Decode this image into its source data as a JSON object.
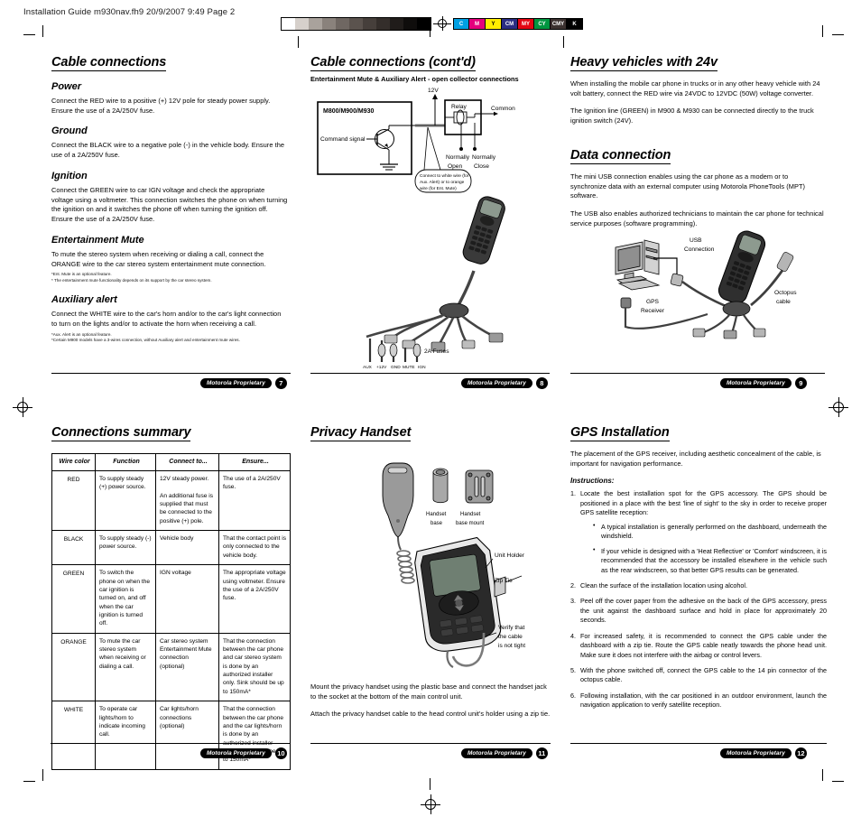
{
  "proof": {
    "header": "Installation Guide m930nav.fh9 20/9/2007 9:49 Page 2",
    "grayscale_swatches": [
      "#ffffff",
      "#d6d0cb",
      "#a9a29c",
      "#8a827c",
      "#6f6762",
      "#5b534e",
      "#463f3b",
      "#342e2b",
      "#201c1a",
      "#0f0d0c",
      "#000000"
    ],
    "cmyk_swatches": [
      {
        "label": "C",
        "color": "#00a0e3"
      },
      {
        "label": "M",
        "color": "#e5007d"
      },
      {
        "label": "Y",
        "color": "#ffec00"
      },
      {
        "label": "CM",
        "color": "#2b2e83"
      },
      {
        "label": "MY",
        "color": "#e30613"
      },
      {
        "label": "CY",
        "color": "#009640"
      },
      {
        "label": "CMY",
        "color": "#3c3230"
      },
      {
        "label": "K",
        "color": "#000000"
      }
    ]
  },
  "footer_badge_label": "Motorola Proprietary",
  "panels": {
    "cable_connections": {
      "title": "Cable connections",
      "page_number": "7",
      "sections": [
        {
          "heading": "Power",
          "paragraphs": [
            "Connect the RED wire to a positive (+) 12V pole for steady power supply. Ensure the use of a 2A/250V fuse."
          ],
          "notes": []
        },
        {
          "heading": "Ground",
          "paragraphs": [
            "Connect the BLACK wire to a negative pole (-) in the vehicle body. Ensure the use of a 2A/250V fuse."
          ],
          "notes": []
        },
        {
          "heading": "Ignition",
          "paragraphs": [
            "Connect the GREEN wire to car IGN voltage and check the appropriate voltage using a voltmeter. This connection switches the phone on when turning the ignition on and it switches the phone off when turning the ignition off. Ensure the use of a 2A/250V fuse."
          ],
          "notes": []
        },
        {
          "heading": "Entertainment Mute",
          "paragraphs": [
            "To mute the stereo system when receiving or dialing a call, connect the ORANGE wire to the car stereo system entertainment mute connection."
          ],
          "notes": [
            "*Ent. Mute is an optional feature.",
            "* The entertainment mute functionality depends on its support by the car stereo system."
          ]
        },
        {
          "heading": "Auxiliary alert",
          "paragraphs": [
            "Connect the WHITE wire to the car's horn and/or to the car's light connection to turn on the lights and/or to activate the horn when receiving a call."
          ],
          "notes": [
            "*Aux. Alert is an optional feature.",
            "*Certain M900 models have a 3-wires connection, without Auxiliary alert and entertainment mute wires."
          ]
        }
      ]
    },
    "cable_connections_contd": {
      "title": "Cable connections (cont'd)",
      "subtitle": "Entertainment Mute & Auxiliary Alert - open collector connections",
      "page_number": "8",
      "diagram": {
        "unit_label": "M800/M900/M930",
        "command_signal": "Command signal",
        "supply": "12V",
        "relay": "Relay",
        "common": "Common",
        "normally_open": [
          "Normally",
          "Open"
        ],
        "normally_close": [
          "Normally",
          "Close"
        ],
        "callout": [
          "Connect to white wire (for",
          "Aux. Alert) or to orange",
          "wire (for  Ent. Mute)"
        ],
        "fuses": "2A Fuses",
        "connector_labels": [
          "AUX",
          "+12V",
          "GND",
          "MUTE",
          "IGN"
        ]
      }
    },
    "heavy_vehicles": {
      "title": "Heavy vehicles with 24v",
      "paragraphs": [
        "When installing the mobile car phone in trucks or in any other heavy vehicle with 24 volt battery, connect the RED wire via 24VDC to 12VDC (50W) voltage converter.",
        "The Ignition line (GREEN) in M900 & M930 can be connected directly to the truck ignition switch (24V)."
      ]
    },
    "data_connection": {
      "title": "Data connection",
      "page_number": "9",
      "paragraphs": [
        "The mini USB connection enables using the car phone as a modem or to synchronize data with an external computer using Motorola PhoneTools (MPT) software.",
        "The USB also enables authorized technicians to maintain the car phone for technical service purposes (software programming)."
      ],
      "diagram_labels": {
        "usb": [
          "USB",
          "Connection"
        ],
        "gps": [
          "GPS",
          "Receiver"
        ],
        "octopus": [
          "Octopus",
          "cable"
        ]
      }
    },
    "connections_summary": {
      "title": "Connections summary",
      "page_number": "10",
      "table": {
        "headers": [
          "Wire color",
          "Function",
          "Connect to...",
          "Ensure..."
        ],
        "rows": [
          {
            "wire_color": "RED",
            "function": "To supply steady (+) power source.",
            "connect_to": "12V steady power.\n\nAn additional fuse is supplied that must be connected to the positive (+) pole.",
            "ensure": "The use of a 2A/250V fuse."
          },
          {
            "wire_color": "BLACK",
            "function": "To supply steady (-) power source.",
            "connect_to": "Vehicle body",
            "ensure": "That the contact point is only connected to the vehicle body."
          },
          {
            "wire_color": "GREEN",
            "function": "To switch the phone on when the car ignition is turned on, and off when the car ignition is turned off.",
            "connect_to": "IGN voltage",
            "ensure": "The appropriate voltage using voltmeter. Ensure the use of a 2A/250V fuse."
          },
          {
            "wire_color": "ORANGE",
            "function": "To mute the car stereo system when receiving or dialing a call.",
            "connect_to": "Car stereo system Entertainment Mute connection (optional)",
            "ensure": "That the connection between the car phone and car stereo system is done by an authorized installer only. Sink should be up to 150mA*"
          },
          {
            "wire_color": "WHITE",
            "function": "To operate car lights/horn to indicate incoming call.",
            "connect_to": "Car lights/horn connections (optional)",
            "ensure": "That the connection between the car phone and the car lights/horn is done by an authorized installer only. Sink should be up to 150mA*"
          }
        ]
      }
    },
    "privacy_handset": {
      "title": "Privacy Handset",
      "page_number": "11",
      "diagram_labels": {
        "handset_base": [
          "Handset",
          "base"
        ],
        "handset_base_mount": [
          "Handset",
          "base mount"
        ],
        "unit_holder": "Unit Holder",
        "zip_tie": "Zip Tie",
        "verify": [
          "Verify that",
          "the cable",
          "is not tight"
        ]
      },
      "paragraphs": [
        "Mount the privacy handset using the plastic base and connect the handset jack to the socket at the bottom of the main control unit.",
        "Attach the privacy handset cable to the head control unit's holder using a zip tie."
      ]
    },
    "gps_installation": {
      "title": "GPS Installation",
      "page_number": "12",
      "intro": "The placement of the GPS receiver, including aesthetic concealment of the cable, is important for navigation performance.",
      "instructions_label": "Instructions:",
      "steps": [
        {
          "text": "Locate the best installation spot for the GPS accessory. The GPS should be positioned in a place with the best 'line of sight' to the sky in order to receive proper GPS satellite reception:",
          "bullets": [
            "A typical installation is generally performed on the dashboard, underneath the windshield.",
            "If your vehicle is designed with a 'Heat Reflective' or 'Comfort' windscreen, it is recommended that the accessory be installed elsewhere in the vehicle such as the rear windscreen, so that better GPS results can be generated."
          ]
        },
        {
          "text": "Clean the surface of the installation location using alcohol.",
          "bullets": []
        },
        {
          "text": "Peel off the cover paper from the adhesive on the back of the GPS accessory, press the unit against the dashboard surface and hold in place for approximately 20 seconds.",
          "bullets": []
        },
        {
          "text": "For increased safety, it is recommended to connect the GPS cable under the dashboard with a zip tie. Route the GPS cable neatly towards the phone head unit. Make sure it does not interfere with the airbag or control levers.",
          "bullets": []
        },
        {
          "text": "With the phone switched off, connect the GPS cable to the 14 pin connector of the octopus cable.",
          "bullets": []
        },
        {
          "text": "Following installation, with the car positioned in an outdoor environment, launch the navigation application to verify satellite reception.",
          "bullets": []
        }
      ]
    }
  }
}
